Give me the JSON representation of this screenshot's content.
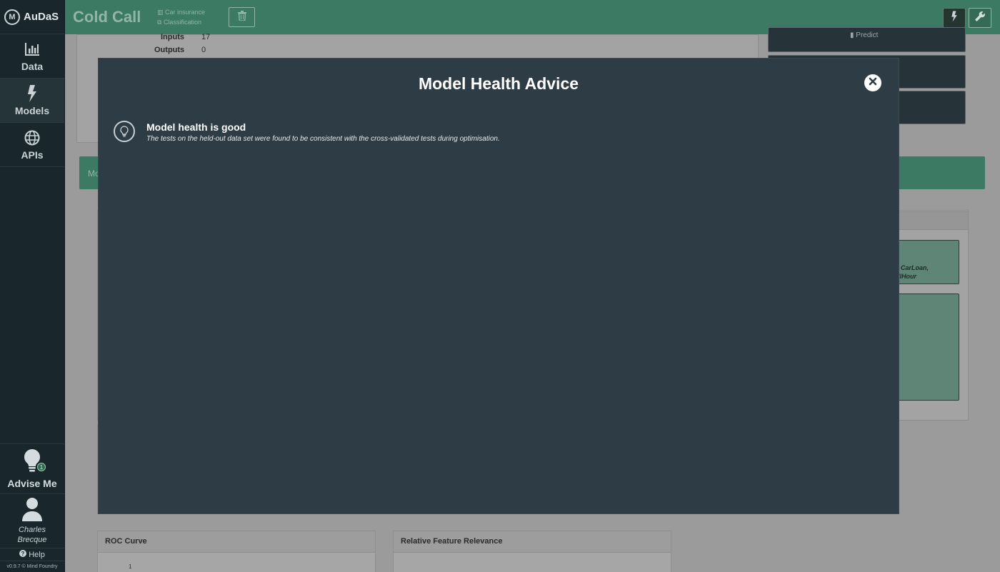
{
  "sidebar": {
    "brand": "AuDaS",
    "items": [
      {
        "label": "Data",
        "icon": "bar-chart-icon"
      },
      {
        "label": "Models",
        "icon": "bolt-icon"
      },
      {
        "label": "APIs",
        "icon": "globe-icon"
      }
    ],
    "advise": {
      "label": "Advise Me",
      "badge": "1"
    },
    "user": {
      "first": "Charles",
      "last": "Brecque"
    },
    "help": "Help",
    "version": "v0.9.7 © Mind Foundry"
  },
  "header": {
    "title": "Cold Call",
    "dataset": "Car insurance",
    "task": "Classification"
  },
  "background": {
    "inputs_label": "Inputs",
    "inputs_value": "17",
    "outputs_label": "Outputs",
    "outputs_value": "0",
    "predict": "Predict",
    "green_bar_text": "Mo",
    "teal_text_1": ", CarLoan,",
    "teal_text_2": "llHour",
    "roc_title": "ROC Curve",
    "roc_tick": "1",
    "relevance_title": "Relative Feature Relevance"
  },
  "modal": {
    "title": "Model Health Advice",
    "advice_title": "Model health is good",
    "advice_desc": "The tests on the held-out data set were found to be consistent with the cross-validated tests during optimisation."
  },
  "colors": {
    "header": "#3d7a63",
    "sidebar": "#19272d",
    "modal": "#2e3c45"
  }
}
